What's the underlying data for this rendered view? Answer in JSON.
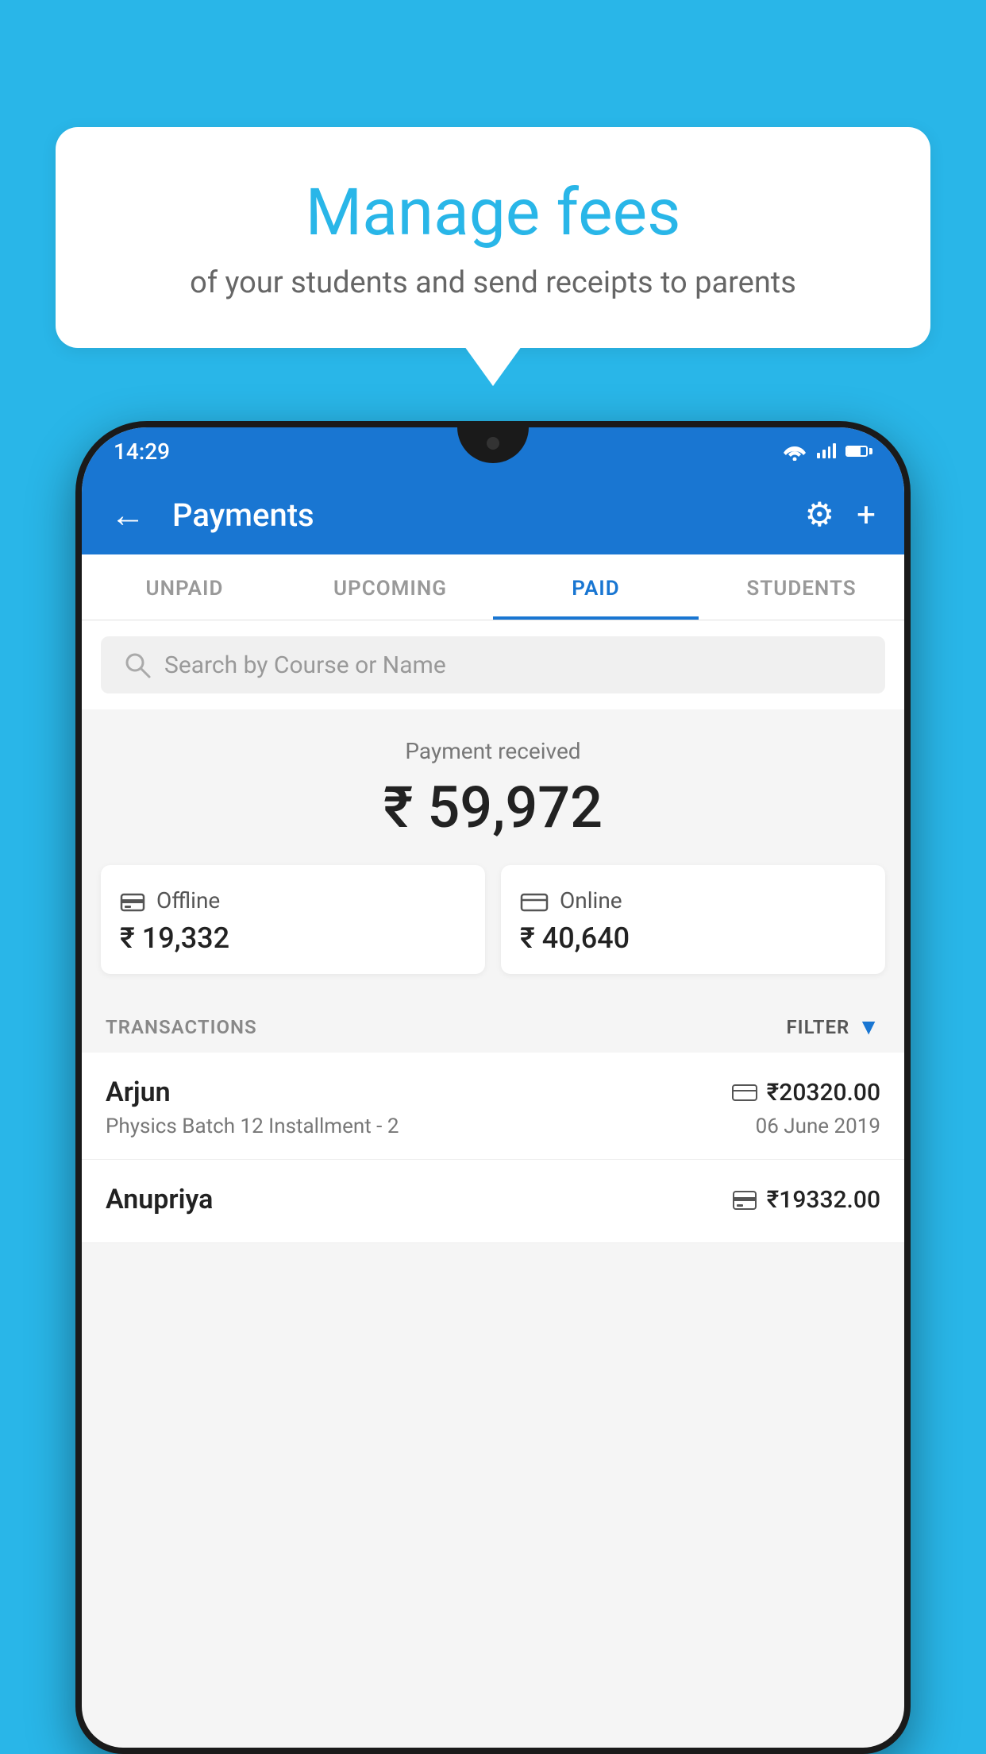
{
  "background_color": "#29b6e8",
  "bubble": {
    "title": "Manage fees",
    "subtitle": "of your students and send receipts to parents"
  },
  "status_bar": {
    "time": "14:29",
    "wifi_icon": "wifi-icon",
    "signal_icon": "signal-icon",
    "battery_icon": "battery-icon"
  },
  "app_bar": {
    "title": "Payments",
    "back_icon": "back-arrow-icon",
    "settings_icon": "gear-icon",
    "add_icon": "plus-icon"
  },
  "tabs": [
    {
      "label": "UNPAID",
      "active": false
    },
    {
      "label": "UPCOMING",
      "active": false
    },
    {
      "label": "PAID",
      "active": true
    },
    {
      "label": "STUDENTS",
      "active": false
    }
  ],
  "search": {
    "placeholder": "Search by Course or Name"
  },
  "payment_summary": {
    "label": "Payment received",
    "amount": "₹ 59,972",
    "offline_label": "Offline",
    "offline_amount": "₹ 19,332",
    "online_label": "Online",
    "online_amount": "₹ 40,640"
  },
  "transactions": {
    "header_label": "TRANSACTIONS",
    "filter_label": "FILTER",
    "items": [
      {
        "name": "Arjun",
        "course": "Physics Batch 12 Installment - 2",
        "amount": "₹20320.00",
        "date": "06 June 2019",
        "payment_type": "online"
      },
      {
        "name": "Anupriya",
        "course": "",
        "amount": "₹19332.00",
        "date": "",
        "payment_type": "offline"
      }
    ]
  }
}
